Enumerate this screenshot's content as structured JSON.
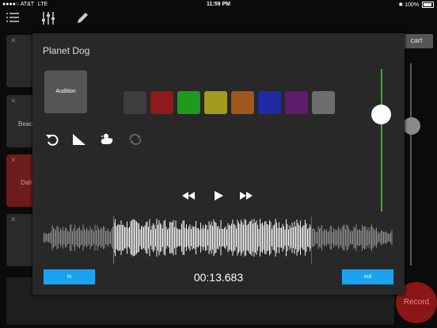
{
  "status_bar": {
    "carrier": "●●●●○ AT&T",
    "network": "LTE",
    "time": "11:59 PM",
    "battery": "100%"
  },
  "background": {
    "cart_label": "cart",
    "record_label": "Record",
    "tile_labels": [
      "Beac",
      "Dah"
    ]
  },
  "dialog": {
    "title": "Planet Dog",
    "audition_label": "Audition",
    "colors": [
      "#3d3d3d",
      "#8e1a1a",
      "#1f9a1f",
      "#a39a22",
      "#a0571b",
      "#1f2aa3",
      "#5e1c6f",
      "#6e6e6e"
    ],
    "selected_color": "none",
    "in_label": "in",
    "out_label": "out",
    "timecode": "00:13.683",
    "volume_level": 0.75,
    "accent_green": "#2cb52c",
    "accent_red": "#d23030",
    "accent_blue": "#1aa3f0"
  }
}
